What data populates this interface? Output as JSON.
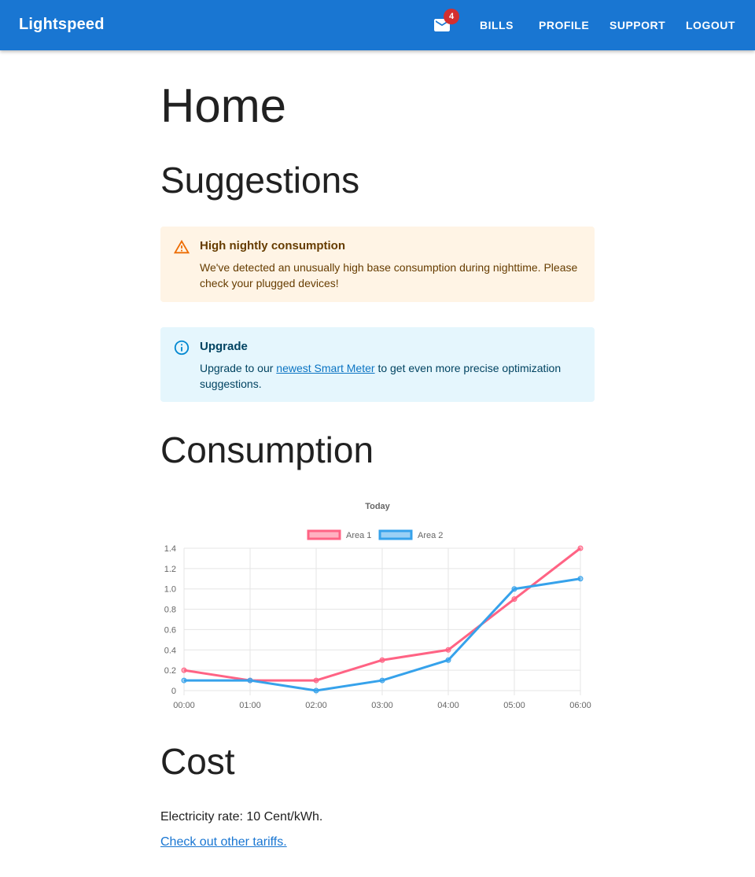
{
  "appbar": {
    "brand": "Lightspeed",
    "mail_badge": "4",
    "nav": {
      "bills": "BILLS",
      "profile": "PROFILE",
      "support": "SUPPORT",
      "logout": "LOGOUT"
    }
  },
  "page": {
    "title": "Home"
  },
  "suggestions": {
    "heading": "Suggestions",
    "warning": {
      "title": "High nightly consumption",
      "body": "We've detected an unusually high base consumption during nighttime. Please check your plugged devices!"
    },
    "info": {
      "title": "Upgrade",
      "body_before": "Upgrade to our ",
      "link": "newest Smart Meter",
      "body_after": " to get even more precise optimization suggestions."
    }
  },
  "consumption": {
    "heading": "Consumption"
  },
  "chart_data": {
    "type": "line",
    "title": "Today",
    "categories": [
      "00:00",
      "01:00",
      "02:00",
      "03:00",
      "04:00",
      "05:00",
      "06:00"
    ],
    "series": [
      {
        "name": "Area 1",
        "color": "#ff6384",
        "values": [
          0.2,
          0.1,
          0.1,
          0.3,
          0.4,
          0.9,
          1.4
        ]
      },
      {
        "name": "Area 2",
        "color": "#36a2eb",
        "values": [
          0.1,
          0.1,
          0.0,
          0.1,
          0.3,
          1.0,
          1.1
        ]
      }
    ],
    "ylim": [
      0,
      1.4
    ],
    "yticks": [
      "0",
      "0.2",
      "0.4",
      "0.6",
      "0.8",
      "1.0",
      "1.2",
      "1.4"
    ],
    "legend": "top",
    "grid": true
  },
  "cost": {
    "heading": "Cost",
    "rate_text": "Electricity rate: 10 Cent/kWh.",
    "tariffs_link": "Check out other tariffs."
  },
  "icons": {
    "mail": "mail-icon",
    "warning": "warning-icon",
    "info": "info-icon"
  }
}
